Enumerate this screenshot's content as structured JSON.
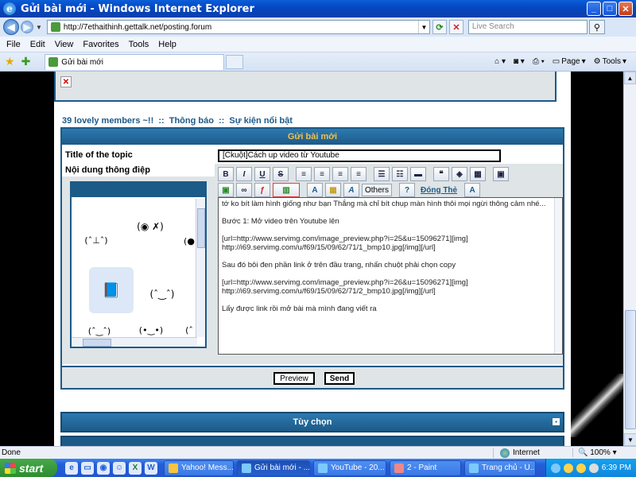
{
  "window": {
    "title": "Gửi bài mới - Windows Internet Explorer",
    "ie_icon": "e"
  },
  "address": {
    "url": "http://7ethaithinh.gettalk.net/posting.forum",
    "search_placeholder": "Live Search"
  },
  "menu": [
    "File",
    "Edit",
    "View",
    "Favorites",
    "Tools",
    "Help"
  ],
  "tabs": {
    "active_label": "Gửi bài mới"
  },
  "commands": {
    "page": "Page",
    "tools": "Tools"
  },
  "breadcrumb": {
    "site": "39 lovely members ~!!",
    "sep": "::",
    "item1": "Thông báo",
    "item2": "Sự kiện nổi bật"
  },
  "post": {
    "header": "Gửi bài mới",
    "title_label": "Title of the topic",
    "title_value": "[Ckuột]Cách up video từ Youtube",
    "content_label": "Nội dung thông điệp",
    "others_label": "Others",
    "dong_the_label": "Đóng Thẻ",
    "editor_lines": [
      "tớ ko bít làm hình giống như bạn Thắng mà chỉ bít chụp màn hình thôi mọi ngừi thông cảm nhé...",
      "Bước 1: Mở video trên Youtube lên",
      "[url=http://www.servimg.com/image_preview.php?i=25&u=15096271][img]\nhttp://i69.servimg.com/u/f69/15/09/62/71/1_bmp10.jpg[/img][/url]",
      "Sau đó bôi đen phần link ở trên đầu trang, nhấn chuột phải chọn copy",
      "[url=http://www.servimg.com/image_preview.php?i=26&u=15096271][img]\nhttp://i69.servimg.com/u/f69/15/09/62/71/2_bmp10.jpg[/img][/url]",
      "Lấy được link rồi mở bài mà mình đang viết ra"
    ],
    "preview_label": "Preview",
    "send_label": "Send",
    "options_label": "Tùy chọn"
  },
  "status": {
    "text": "Done",
    "zone": "Internet",
    "zoom": "100%"
  },
  "taskbar": {
    "start": "start",
    "tasks": [
      "Yahoo! Mess...",
      "Gửi bài mới - ...",
      "YouTube - 20...",
      "2 - Paint",
      "Trang chủ - U..."
    ],
    "clock": "6:39 PM"
  }
}
